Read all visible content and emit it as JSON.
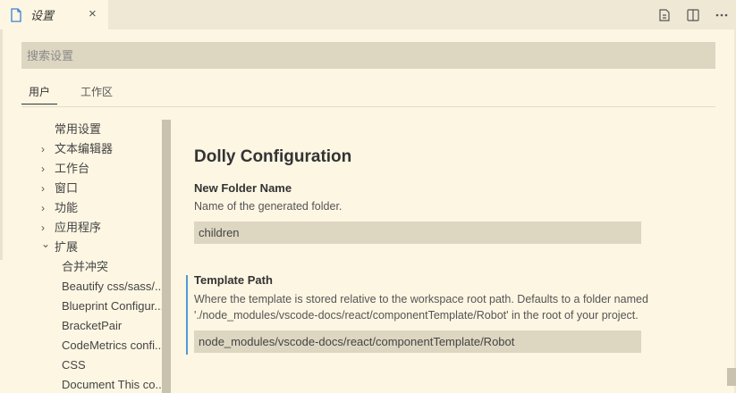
{
  "tab": {
    "title": "设置",
    "icon": "file-icon",
    "close": "×"
  },
  "actions": [
    {
      "name": "open-settings-json-icon",
      "glyph": "⧉"
    },
    {
      "name": "split-editor-icon",
      "glyph": "◫"
    },
    {
      "name": "more-actions-icon",
      "glyph": "···"
    }
  ],
  "search": {
    "placeholder": "搜索设置",
    "value": ""
  },
  "scopes": {
    "user": "用户",
    "workspace": "工作区"
  },
  "toc": [
    {
      "label": "常用设置",
      "indent": 0,
      "chevron": ""
    },
    {
      "label": "文本编辑器",
      "indent": 0,
      "chevron": "›"
    },
    {
      "label": "工作台",
      "indent": 0,
      "chevron": "›"
    },
    {
      "label": "窗口",
      "indent": 0,
      "chevron": "›"
    },
    {
      "label": "功能",
      "indent": 0,
      "chevron": "›"
    },
    {
      "label": "应用程序",
      "indent": 0,
      "chevron": "›"
    },
    {
      "label": "扩展",
      "indent": 0,
      "chevron": "⌄"
    },
    {
      "label": "合并冲突",
      "indent": 1,
      "chevron": ""
    },
    {
      "label": "Beautify css/sass/...",
      "indent": 1,
      "chevron": ""
    },
    {
      "label": "Blueprint Configur...",
      "indent": 1,
      "chevron": ""
    },
    {
      "label": "BracketPair",
      "indent": 1,
      "chevron": ""
    },
    {
      "label": "CodeMetrics confi...",
      "indent": 1,
      "chevron": ""
    },
    {
      "label": "CSS",
      "indent": 1,
      "chevron": ""
    },
    {
      "label": "Document This co...",
      "indent": 1,
      "chevron": ""
    }
  ],
  "section": {
    "title": "Dolly Configuration",
    "settings": [
      {
        "label": "New Folder Name",
        "description": "Name of the generated folder.",
        "value": "children"
      },
      {
        "label": "Template Path",
        "description": "Where the template is stored relative to the workspace root path. Defaults to a folder named './node_modules/vscode-docs/react/componentTemplate/Robot' in the root of your project.",
        "value": "node_modules/vscode-docs/react/componentTemplate/Robot"
      }
    ]
  },
  "colors": {
    "background": "#fdf6e3",
    "input": "#ddd6c1",
    "focus": "#4f9ad8"
  }
}
